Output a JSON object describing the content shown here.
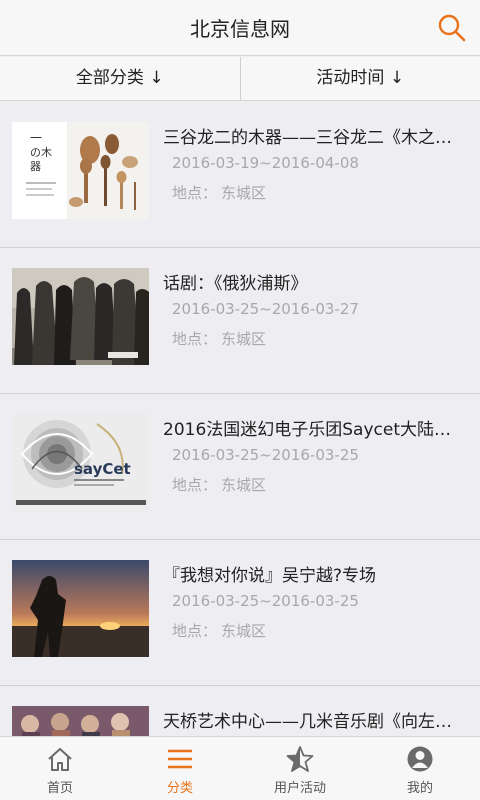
{
  "header": {
    "title": "北京信息网",
    "search_icon": "search-icon",
    "accent": "#e8731c"
  },
  "filter": {
    "category": "全部分类 ↓",
    "time": "活动时间 ↓"
  },
  "events": [
    {
      "title": "三谷龙二的木器——三谷龙二《木之…",
      "date": "2016-03-19~2016-04-08",
      "location_label": "地点：",
      "location": "东城区"
    },
    {
      "title": "话剧：《俄狄浦斯》",
      "date": "2016-03-25~2016-03-27",
      "location_label": "地点：",
      "location": "东城区"
    },
    {
      "title": "2016法国迷幻电子乐团Saycet大陆…",
      "date": "2016-03-25~2016-03-25",
      "location_label": "地点：",
      "location": "东城区"
    },
    {
      "title": "『我想对你说』吴宁越?专场",
      "date": "2016-03-25~2016-03-25",
      "location_label": "地点：",
      "location": "东城区"
    },
    {
      "title": "天桥艺术中心——几米音乐剧《向左…",
      "date": "",
      "location_label": "",
      "location": ""
    }
  ],
  "tabs": [
    {
      "label": "首页",
      "icon": "home-icon",
      "active": false
    },
    {
      "label": "分类",
      "icon": "menu-icon",
      "active": true
    },
    {
      "label": "用户活动",
      "icon": "star-icon",
      "active": false
    },
    {
      "label": "我的",
      "icon": "user-icon",
      "active": false
    }
  ]
}
